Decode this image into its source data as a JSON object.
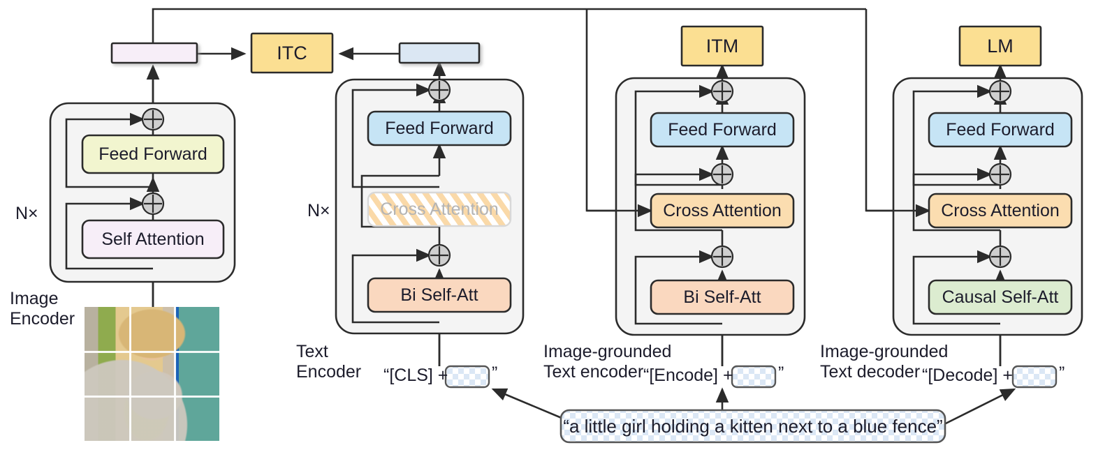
{
  "figure": {
    "title": "BLIP pre-training model architecture and objectives",
    "type": "diagram"
  },
  "palette": {
    "image_ff": "#f2f5cf",
    "image_sa": "#f7eef8",
    "text_ff": "#c6e4f5",
    "text_bi_selfatt": "#fad8bf",
    "cross_attention": "#fbddb0",
    "causal_selfatt": "#dcecd0",
    "objective_head": "#fbdf92",
    "container": "#f4f4f4",
    "feature_image": "#f7eef8",
    "feature_text": "#dbe7f3",
    "stroke": "#2b2b2b",
    "text": "#1c1c2b",
    "ghost_text": "#b4b4b4"
  },
  "columns": [
    {
      "id": "image-encoder",
      "caption": "Image\nEncoder",
      "repeat_label": "N×",
      "blocks": [
        {
          "id": "self-attention",
          "label": "Self Attention"
        },
        {
          "id": "feed-forward",
          "label": "Feed Forward"
        }
      ],
      "feature_bar": {
        "id": "image-feature",
        "label": ""
      }
    },
    {
      "id": "text-encoder",
      "caption": "Text\nEncoder",
      "repeat_label": "N×",
      "blocks": [
        {
          "id": "bi-self-att",
          "label": "Bi Self-Att"
        },
        {
          "id": "cross-attention",
          "label": "Cross Attention",
          "disabled": true
        },
        {
          "id": "feed-forward",
          "label": "Feed Forward"
        }
      ],
      "feature_bar": {
        "id": "text-feature",
        "label": ""
      },
      "input_token": {
        "prefix": "“[CLS] +",
        "suffix": "”"
      }
    },
    {
      "id": "image-grounded-text-encoder",
      "caption": "Image-grounded\nText encoder",
      "blocks": [
        {
          "id": "bi-self-att",
          "label": "Bi Self-Att"
        },
        {
          "id": "cross-attention",
          "label": "Cross Attention"
        },
        {
          "id": "feed-forward",
          "label": "Feed Forward"
        }
      ],
      "head": {
        "id": "itm-head",
        "label": "ITM"
      },
      "input_token": {
        "prefix": "“[Encode] +",
        "suffix": "”"
      }
    },
    {
      "id": "image-grounded-text-decoder",
      "caption": "Image-grounded\nText decoder",
      "blocks": [
        {
          "id": "causal-self-att",
          "label": "Causal Self-Att"
        },
        {
          "id": "cross-attention",
          "label": "Cross Attention"
        },
        {
          "id": "feed-forward",
          "label": "Feed Forward"
        }
      ],
      "head": {
        "id": "lm-head",
        "label": "LM"
      },
      "input_token": {
        "prefix": "“[Decode] +",
        "suffix": "”"
      }
    }
  ],
  "objectives": [
    {
      "id": "itc-head",
      "label": "ITC"
    },
    {
      "id": "itm-head",
      "label": "ITM"
    },
    {
      "id": "lm-head",
      "label": "LM"
    }
  ],
  "caption_box": {
    "text": "“a little girl holding a kitten next to a blue fence”"
  },
  "image_input": {
    "alt": "photo of a girl holding a kitten in front of a blue fence",
    "patch_grid": "3x3"
  }
}
